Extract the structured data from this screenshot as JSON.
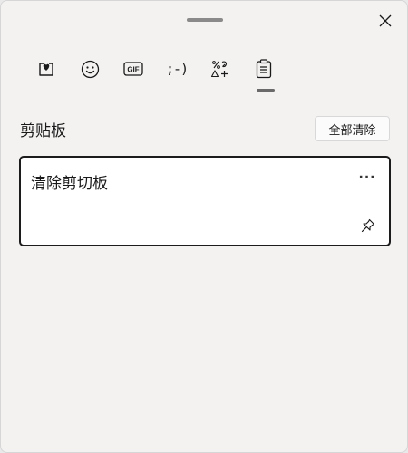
{
  "window": {
    "close_icon": "close-icon",
    "drag_handle": "drag-handle"
  },
  "tabs": [
    {
      "name": "tab-stickers",
      "icon": "heart-sticker-icon"
    },
    {
      "name": "tab-emoji",
      "icon": "smiley-icon"
    },
    {
      "name": "tab-gif",
      "icon": "gif-icon",
      "label": "GIF"
    },
    {
      "name": "tab-kaomoji",
      "icon": "kaomoji-icon",
      "label": ";-)"
    },
    {
      "name": "tab-symbols",
      "icon": "symbols-icon"
    },
    {
      "name": "tab-clipboard",
      "icon": "clipboard-icon",
      "active": true
    }
  ],
  "clipboard": {
    "title": "剪贴板",
    "clear_all_label": "全部清除",
    "items": [
      {
        "text": "清除剪切板",
        "more_label": "···",
        "pin_icon": "pin-icon"
      }
    ]
  },
  "colors": {
    "panel_bg": "#f3f2f1",
    "card_border": "#1c1c1c",
    "text": "#1a1a1a"
  }
}
